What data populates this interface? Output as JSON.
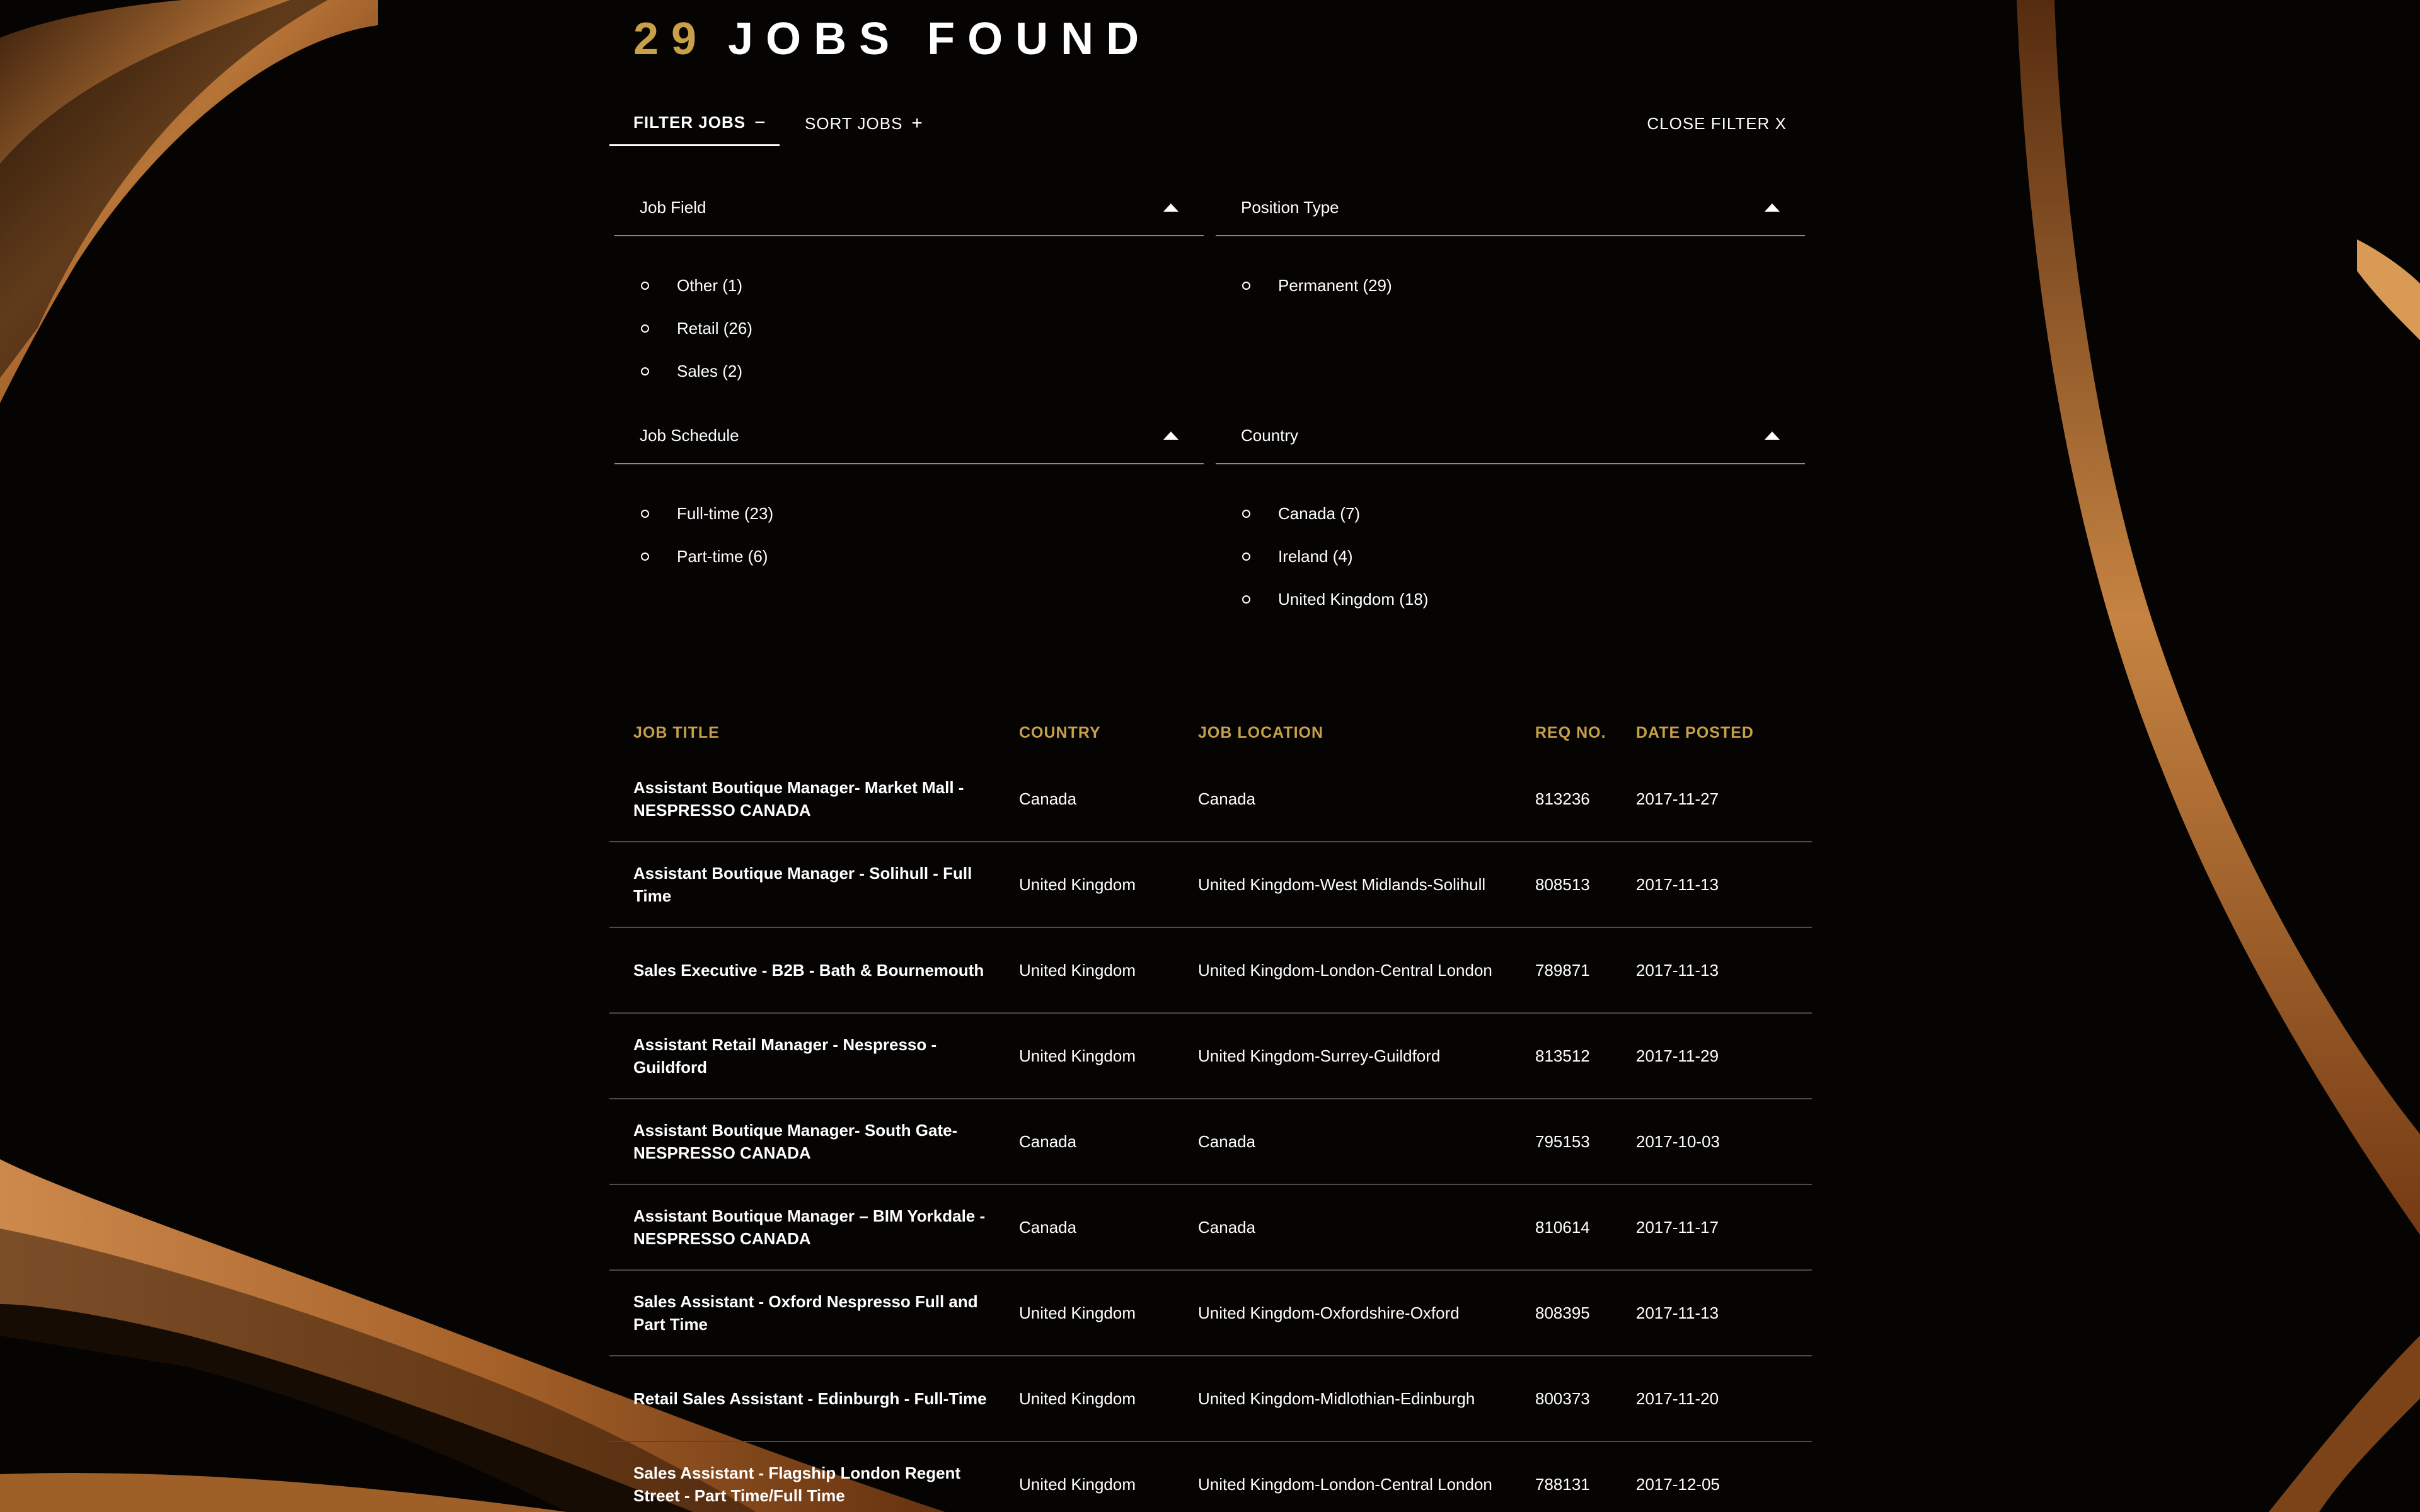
{
  "header": {
    "count": "29",
    "label": "JOBS FOUND"
  },
  "tabs": {
    "filter_label": "FILTER JOBS",
    "filter_symbol": "−",
    "sort_label": "SORT JOBS",
    "sort_symbol": "+",
    "close_label": "CLOSE FILTER X"
  },
  "filters": {
    "job_field": {
      "title": "Job Field",
      "options": [
        "Other (1)",
        "Retail (26)",
        "Sales (2)"
      ]
    },
    "position_type": {
      "title": "Position Type",
      "options": [
        "Permanent (29)"
      ]
    },
    "job_schedule": {
      "title": "Job Schedule",
      "options": [
        "Full-time (23)",
        "Part-time (6)"
      ]
    },
    "country": {
      "title": "Country",
      "options": [
        "Canada (7)",
        "Ireland (4)",
        "United Kingdom (18)"
      ]
    }
  },
  "table": {
    "columns": [
      "JOB TITLE",
      "COUNTRY",
      "JOB LOCATION",
      "REQ NO.",
      "DATE POSTED"
    ],
    "rows": [
      {
        "title": "Assistant Boutique Manager- Market Mall - NESPRESSO CANADA",
        "country": "Canada",
        "location": "Canada",
        "req": "813236",
        "date": "2017-11-27"
      },
      {
        "title": "Assistant Boutique Manager - Solihull - Full Time",
        "country": "United Kingdom",
        "location": "United Kingdom-West Midlands-Solihull",
        "req": "808513",
        "date": "2017-11-13"
      },
      {
        "title": "Sales Executive - B2B - Bath & Bournemouth",
        "country": "United Kingdom",
        "location": "United Kingdom-London-Central London",
        "req": "789871",
        "date": "2017-11-13"
      },
      {
        "title": "Assistant Retail Manager - Nespresso - Guildford",
        "country": "United Kingdom",
        "location": "United Kingdom-Surrey-Guildford",
        "req": "813512",
        "date": "2017-11-29"
      },
      {
        "title": "Assistant Boutique Manager- South Gate- NESPRESSO CANADA",
        "country": "Canada",
        "location": "Canada",
        "req": "795153",
        "date": "2017-10-03"
      },
      {
        "title": "Assistant Boutique Manager – BIM Yorkdale - NESPRESSO CANADA",
        "country": "Canada",
        "location": "Canada",
        "req": "810614",
        "date": "2017-11-17"
      },
      {
        "title": "Sales Assistant - Oxford Nespresso Full and Part Time",
        "country": "United Kingdom",
        "location": "United Kingdom-Oxfordshire-Oxford",
        "req": "808395",
        "date": "2017-11-13"
      },
      {
        "title": "Retail Sales Assistant - Edinburgh - Full-Time",
        "country": "United Kingdom",
        "location": "United Kingdom-Midlothian-Edinburgh",
        "req": "800373",
        "date": "2017-11-20"
      },
      {
        "title": "Sales Assistant - Flagship London Regent Street - Part Time/Full Time",
        "country": "United Kingdom",
        "location": "United Kingdom-London-Central London",
        "req": "788131",
        "date": "2017-12-05"
      }
    ]
  },
  "colors": {
    "accent": "#c8a04a",
    "background": "#000000",
    "text": "#ffffff"
  }
}
